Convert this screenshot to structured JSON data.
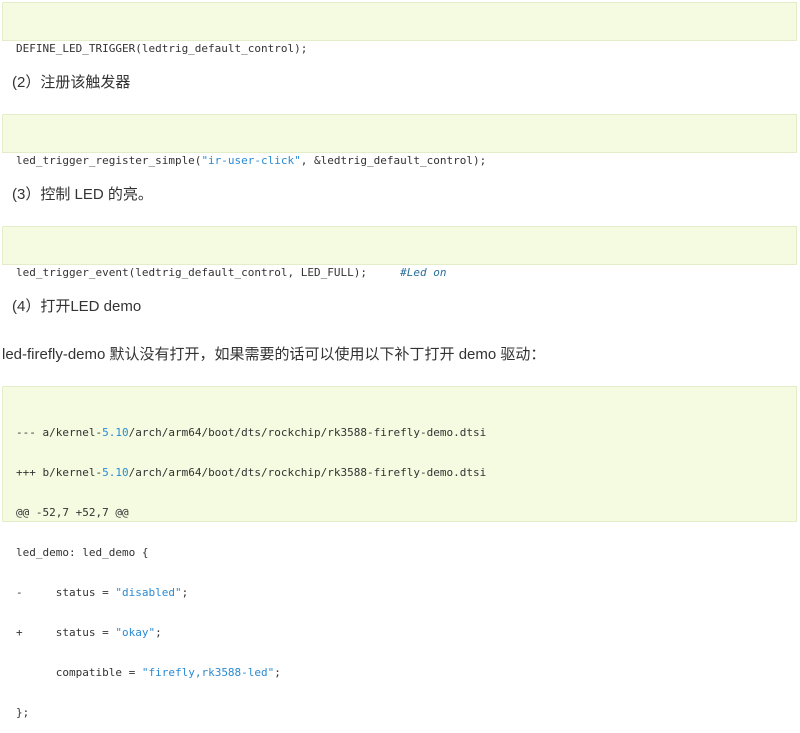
{
  "code_block_1": {
    "lines": [
      "DEFINE_LED_TRIGGER(ledtrig_default_control);"
    ]
  },
  "heading_2": "(2）注册该触发器",
  "code_block_2": {
    "prefix": "led_trigger_register_simple(",
    "string": "\"ir-user-click\"",
    "suffix": ", &ledtrig_default_control);"
  },
  "heading_3": "(3）控制 LED 的亮。",
  "code_block_3": {
    "code": "led_trigger_event(ledtrig_default_control, LED_FULL);     ",
    "comment": "#Led on"
  },
  "heading_4": "(4）打开LED demo",
  "paragraph": "led-firefly-demo 默认没有打开，如果需要的话可以使用以下补丁打开 demo 驱动：",
  "patch": {
    "line1_a": "--- a/kernel-",
    "line1_ver": "5.10",
    "line1_b": "/arch/arm64/boot/dts/rockchip/rk3588-firefly-demo.dtsi",
    "line2_a": "+++ b/kernel-",
    "line2_ver": "5.10",
    "line2_b": "/arch/arm64/boot/dts/rockchip/rk3588-firefly-demo.dtsi",
    "line3": "@@ -52,7 +52,7 @@",
    "line4": "led_demo: led_demo {",
    "line5_a": "-     status = ",
    "line5_str": "\"disabled\"",
    "line5_b": ";",
    "line6_a": "+     status = ",
    "line6_str": "\"okay\"",
    "line6_b": ";",
    "line7_a": "      compatible = ",
    "line7_str": "\"firefly,rk3588-led\"",
    "line7_b": ";",
    "line8": "};"
  }
}
